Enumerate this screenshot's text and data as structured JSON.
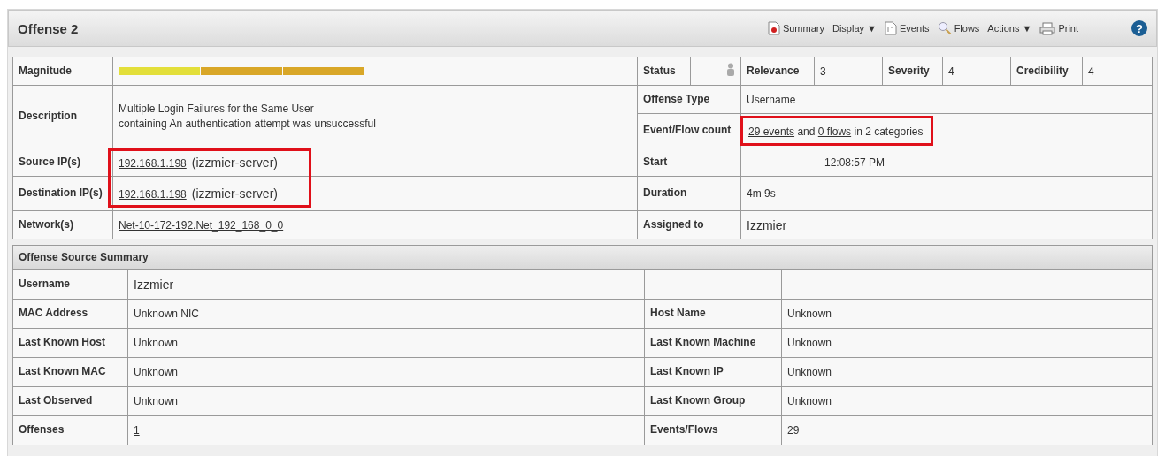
{
  "header": {
    "title": "Offense 2",
    "help": "?",
    "toolbar": [
      {
        "kind": "summary",
        "label": "Summary"
      },
      {
        "kind": "dropdown",
        "label": "Display ▼"
      },
      {
        "kind": "events",
        "label": "Events"
      },
      {
        "kind": "flows",
        "label": "Flows"
      },
      {
        "kind": "dropdown",
        "label": "Actions ▼"
      },
      {
        "kind": "print",
        "label": "Print"
      }
    ]
  },
  "offense": {
    "magnitude": {
      "label": "Magnitude",
      "segments": [
        {
          "color": "#e3df3a"
        },
        {
          "color": "#d9a728"
        },
        {
          "color": "#d9a728"
        }
      ]
    },
    "status": {
      "label": "Status"
    },
    "relevance": {
      "label": "Relevance",
      "value": "3"
    },
    "severity": {
      "label": "Severity",
      "value": "4"
    },
    "credibility": {
      "label": "Credibility",
      "value": "4"
    },
    "description": {
      "label": "Description",
      "lines": [
        "Multiple Login Failures for the Same User",
        "containing An authentication attempt was unsuccessful"
      ]
    },
    "offense_type": {
      "label": "Offense Type",
      "value": "Username"
    },
    "event_flow_count": {
      "label": "Event/Flow count",
      "highlighted": true,
      "parts": [
        {
          "text": "29 events",
          "link": true
        },
        {
          "text": "and",
          "link": false
        },
        {
          "text": "0 flows",
          "link": true
        },
        {
          "text": "in 2 categories",
          "link": false
        }
      ]
    },
    "source_ips": {
      "label": "Source IP(s)",
      "ip": "192.168.1.198",
      "host": "(izzmier-server)"
    },
    "destination_ips": {
      "label": "Destination IP(s)",
      "ip": "192.168.1.198",
      "host": "(izzmier-server)"
    },
    "ips_highlighted": true,
    "start": {
      "label": "Start",
      "value": "12:08:57 PM"
    },
    "duration": {
      "label": "Duration",
      "value": "4m 9s"
    },
    "networks": {
      "label": "Network(s)",
      "value": "Net-10-172-192.Net_192_168_0_0"
    },
    "assigned_to": {
      "label": "Assigned to",
      "value": "Izzmier"
    }
  },
  "source_summary": {
    "title": "Offense Source Summary",
    "rows": [
      {
        "label": "Username",
        "value": "Izzmier",
        "value_link": false
      },
      {
        "label": "MAC Address",
        "value": "Unknown NIC",
        "value_link": false,
        "label_2": "Host Name",
        "value_2": "Unknown"
      },
      {
        "label": "Last Known Host",
        "value": "Unknown",
        "value_link": false,
        "label_2": "Last Known Machine",
        "value_2": "Unknown"
      },
      {
        "label": "Last Known MAC",
        "value": "Unknown",
        "value_link": false,
        "label_2": "Last Known IP",
        "value_2": "Unknown"
      },
      {
        "label": "Last Observed",
        "value": "Unknown",
        "value_link": false,
        "label_2": "Last Known Group",
        "value_2": "Unknown"
      },
      {
        "label": "Offenses",
        "value": "1",
        "value_link": true,
        "label_2": "Events/Flows",
        "value_2": "29"
      }
    ]
  }
}
